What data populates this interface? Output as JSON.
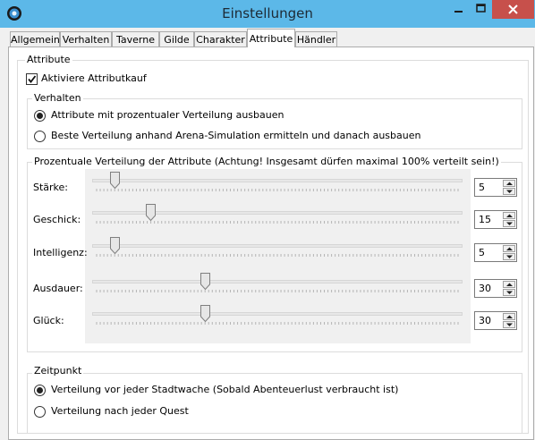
{
  "window": {
    "title": "Einstellungen"
  },
  "tabs": [
    {
      "label": "Allgemein"
    },
    {
      "label": "Verhalten"
    },
    {
      "label": "Taverne"
    },
    {
      "label": "Gilde"
    },
    {
      "label": "Charakter"
    },
    {
      "label": "Attribute",
      "active": true
    },
    {
      "label": "Händler"
    }
  ],
  "attribute_group": {
    "legend": "Attribute",
    "checkbox_label": "Aktiviere Attributkauf",
    "checked": true
  },
  "behavior_group": {
    "legend": "Verhalten",
    "options": [
      {
        "label": "Attribute mit prozentualer Verteilung ausbauen",
        "selected": true
      },
      {
        "label": "Beste Verteilung anhand Arena-Simulation ermitteln und danach ausbauen",
        "selected": false
      }
    ]
  },
  "distribution_group": {
    "legend": "Prozentuale Verteilung der Attribute (Achtung! Insgesamt dürfen maximal 100% verteilt sein!)",
    "attributes": [
      {
        "label": "Stärke:",
        "value": "5",
        "level": 5
      },
      {
        "label": "Geschick:",
        "value": "15",
        "level": 15
      },
      {
        "label": "Intelligenz:",
        "value": "5",
        "level": 5
      },
      {
        "label": "Ausdauer:",
        "value": "30",
        "level": 30
      },
      {
        "label": "Glück:",
        "value": "30",
        "level": 30
      }
    ],
    "max": 100
  },
  "timing_group": {
    "legend": "Zeitpunkt",
    "options": [
      {
        "label": "Verteilung vor jeder Stadtwache (Sobald Abenteuerlust verbraucht ist)",
        "selected": true
      },
      {
        "label": "Verteilung nach jeder Quest",
        "selected": false
      }
    ]
  },
  "colors": {
    "titlebar": "#5cb8e8",
    "close_button": "#c7504b"
  }
}
